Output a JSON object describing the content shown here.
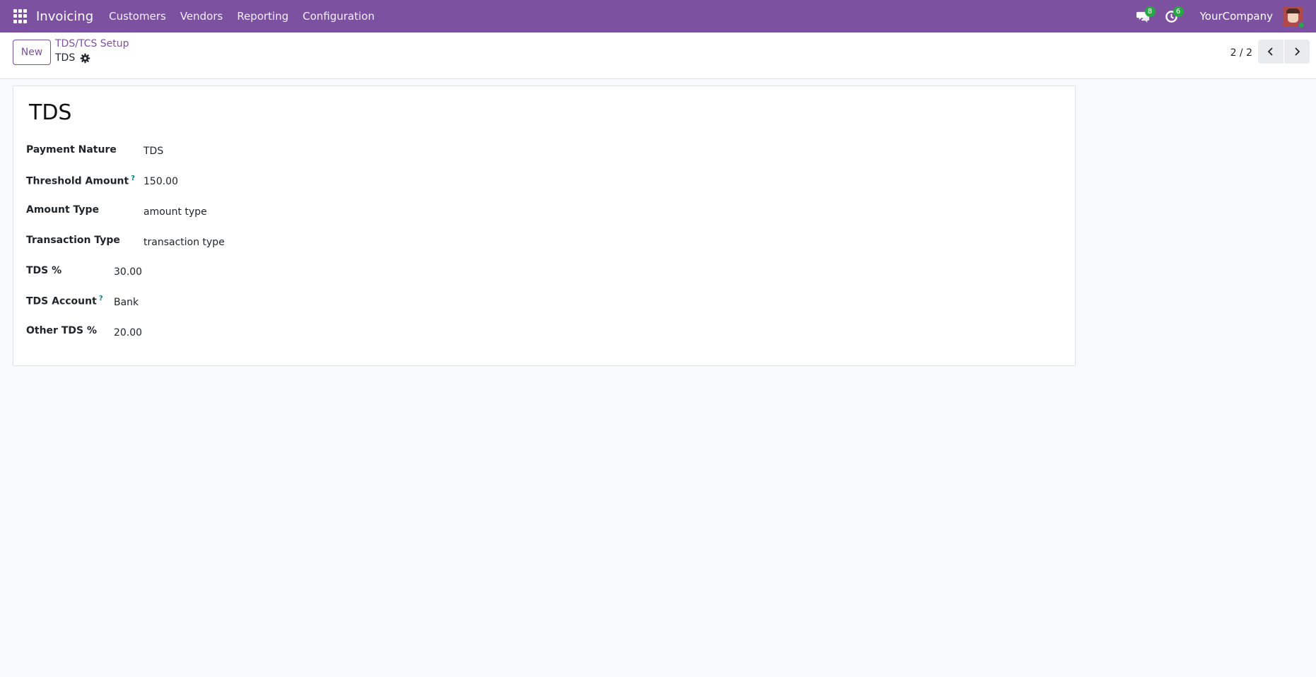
{
  "navbar": {
    "brand": "Invoicing",
    "menu": [
      "Customers",
      "Vendors",
      "Reporting",
      "Configuration"
    ],
    "messages_badge": "8",
    "activities_badge": "6",
    "company": "YourCompany",
    "accent_color": "#7c519f",
    "badge_color": "#28a745"
  },
  "control_panel": {
    "new_label": "New",
    "breadcrumb_parent": "TDS/TCS Setup",
    "breadcrumb_current": "TDS",
    "pager": "2 / 2"
  },
  "form": {
    "title": "TDS",
    "help_marker": "?",
    "fields": [
      {
        "label": "Payment Nature",
        "value": "TDS"
      },
      {
        "label": "Threshold Amount",
        "value": "150.00",
        "help": true
      },
      {
        "label": "Amount Type",
        "value": "amount type"
      },
      {
        "label": "Transaction Type",
        "value": "transaction type"
      },
      {
        "label": "TDS %",
        "value": "30.00"
      },
      {
        "label": "TDS Account",
        "value": "Bank",
        "help": true
      },
      {
        "label": "Other TDS %",
        "value": "20.00"
      }
    ]
  }
}
